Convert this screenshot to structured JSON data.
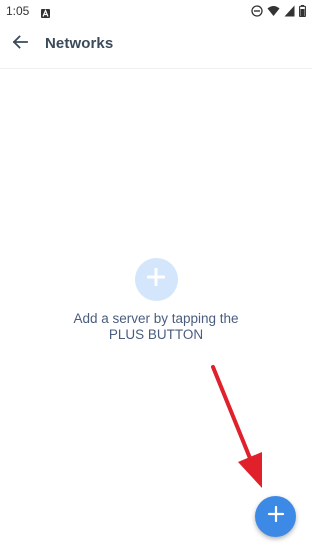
{
  "status_bar": {
    "time": "1:05",
    "notification_icon": "a-letter-icon",
    "icons": [
      "do-not-disturb-icon",
      "wifi-icon",
      "cell-signal-icon",
      "battery-icon"
    ]
  },
  "app_bar": {
    "back_icon": "arrow-left-icon",
    "title": "Networks"
  },
  "empty_state": {
    "icon": "plus-icon",
    "line1": "Add a server by tapping the",
    "line2": "PLUS BUTTON"
  },
  "fab": {
    "icon": "plus-icon"
  },
  "colors": {
    "accent": "#3d8ae6",
    "empty_icon_bg": "#d4e6fb",
    "title": "#3b4a5a",
    "empty_text": "#4a5d7e",
    "annotation_arrow": "#e0202a"
  }
}
